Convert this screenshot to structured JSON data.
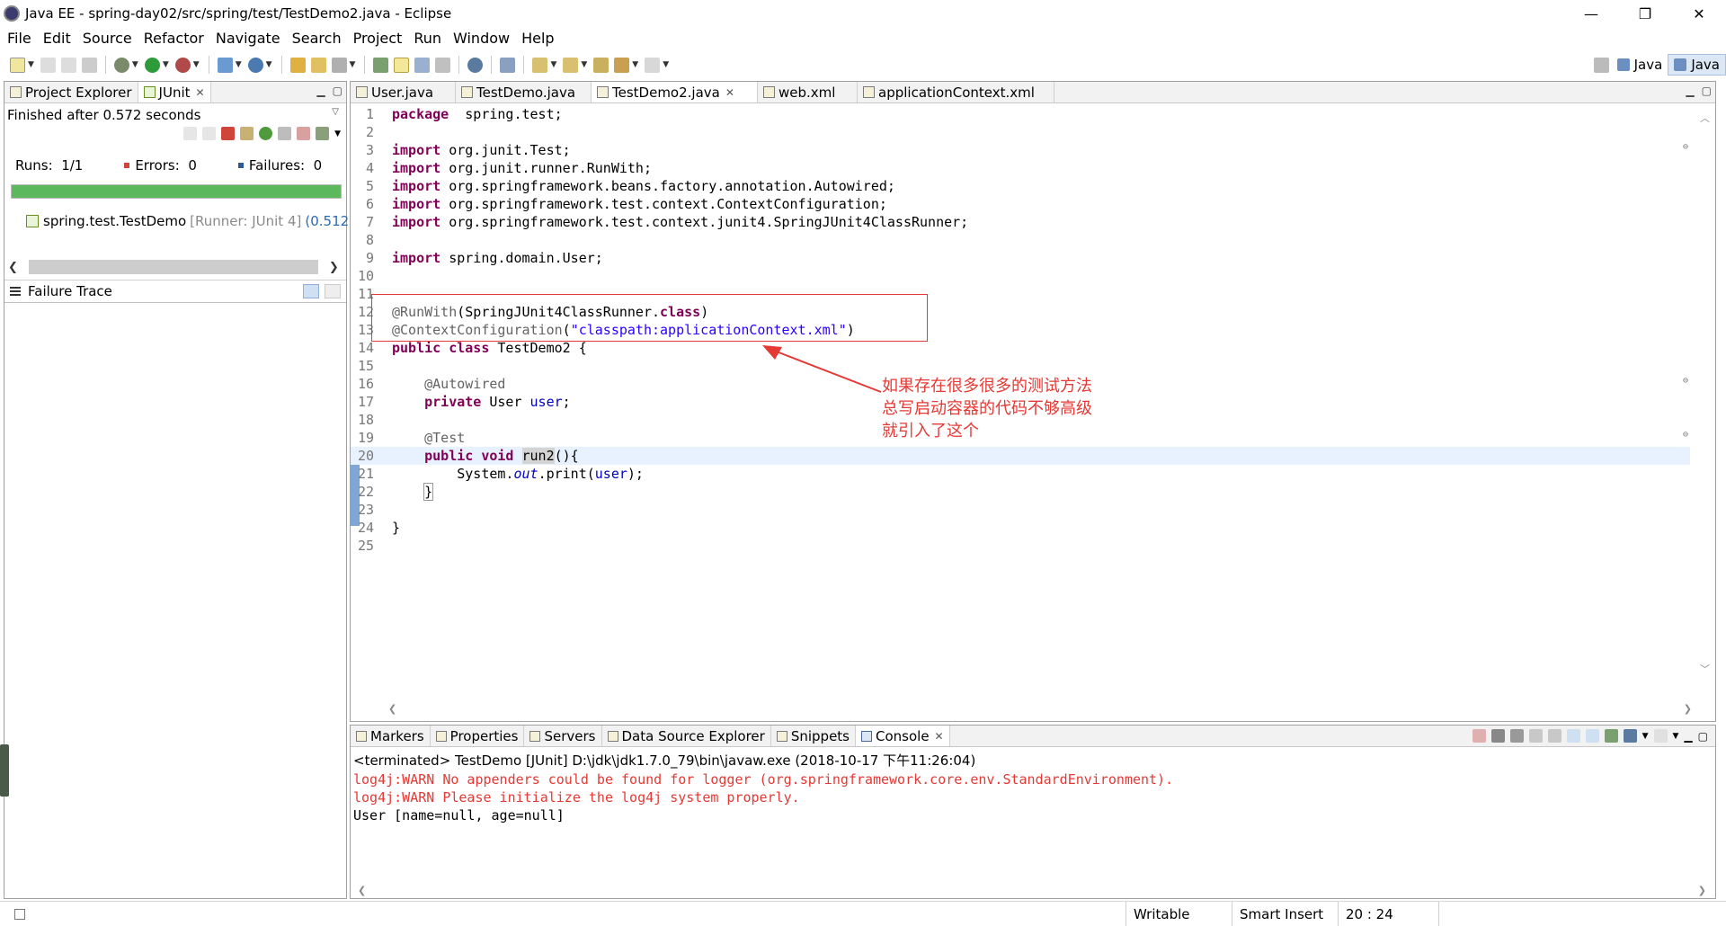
{
  "window": {
    "title": "Java EE - spring-day02/src/spring/test/TestDemo2.java - Eclipse",
    "controls": [
      "—",
      "❐",
      "✕"
    ]
  },
  "menu": [
    "File",
    "Edit",
    "Source",
    "Refactor",
    "Navigate",
    "Search",
    "Project",
    "Run",
    "Window",
    "Help"
  ],
  "perspectives": [
    "Java",
    "Java"
  ],
  "left_panel": {
    "tabs": [
      "Project Explorer",
      "JUnit"
    ],
    "status": "Finished after 0.572 seconds",
    "runs_label": "Runs:",
    "runs_value": "1/1",
    "errors_label": "Errors:",
    "errors_value": "0",
    "failures_label": "Failures:",
    "failures_value": "0",
    "progress": 1.0,
    "progress_color": "#5cb85c",
    "tree_item": "spring.test.TestDemo",
    "tree_runner": "[Runner: JUnit 4]",
    "tree_time": "(0.512",
    "failure_trace": "Failure Trace"
  },
  "editor": {
    "tabs": [
      "User.java",
      "TestDemo.java",
      "TestDemo2.java",
      "web.xml",
      "applicationContext.xml"
    ],
    "active_tab": "TestDemo2.java",
    "lines": [
      {
        "n": "1",
        "segs": [
          [
            "kw",
            "package"
          ],
          [
            "",
            "  spring.test;"
          ]
        ]
      },
      {
        "n": "2",
        "segs": []
      },
      {
        "n": "3",
        "fold": true,
        "segs": [
          [
            "kw",
            "import"
          ],
          [
            "",
            " org.junit.Test;"
          ]
        ]
      },
      {
        "n": "4",
        "segs": [
          [
            "kw",
            "import"
          ],
          [
            "",
            " org.junit.runner.RunWith;"
          ]
        ]
      },
      {
        "n": "5",
        "segs": [
          [
            "kw",
            "import"
          ],
          [
            "",
            " org.springframework.beans.factory.annotation.Autowired;"
          ]
        ]
      },
      {
        "n": "6",
        "segs": [
          [
            "kw",
            "import"
          ],
          [
            "",
            " org.springframework.test.context.ContextConfiguration;"
          ]
        ]
      },
      {
        "n": "7",
        "segs": [
          [
            "kw",
            "import"
          ],
          [
            "",
            " org.springframework.test.context.junit4.SpringJUnit4ClassRunner;"
          ]
        ]
      },
      {
        "n": "8",
        "segs": []
      },
      {
        "n": "9",
        "segs": [
          [
            "kw",
            "import"
          ],
          [
            "",
            " spring.domain.User;"
          ]
        ]
      },
      {
        "n": "10",
        "segs": []
      },
      {
        "n": "11",
        "segs": []
      },
      {
        "n": "12",
        "segs": [
          [
            "ann",
            "@RunWith"
          ],
          [
            "",
            "(SpringJUnit4ClassRunner."
          ],
          [
            "kw",
            "class"
          ],
          [
            "",
            ")"
          ]
        ]
      },
      {
        "n": "13",
        "segs": [
          [
            "ann",
            "@ContextConfiguration"
          ],
          [
            "",
            "("
          ],
          [
            "str",
            "\"classpath:applicationContext.xml\""
          ],
          [
            "",
            ")"
          ]
        ]
      },
      {
        "n": "14",
        "segs": [
          [
            "kw",
            "public"
          ],
          [
            "",
            " "
          ],
          [
            "kw",
            "class"
          ],
          [
            "",
            " TestDemo2 {"
          ]
        ]
      },
      {
        "n": "15",
        "segs": []
      },
      {
        "n": "16",
        "fold": true,
        "segs": [
          [
            "",
            "    "
          ],
          [
            "ann",
            "@Autowired"
          ]
        ]
      },
      {
        "n": "17",
        "segs": [
          [
            "",
            "    "
          ],
          [
            "kw",
            "private"
          ],
          [
            "",
            " User "
          ],
          [
            "fld",
            "user"
          ],
          [
            "",
            ";"
          ]
        ]
      },
      {
        "n": "18",
        "segs": []
      },
      {
        "n": "19",
        "fold": true,
        "segs": [
          [
            "",
            "    "
          ],
          [
            "ann",
            "@Test"
          ]
        ]
      },
      {
        "n": "20",
        "hl": true,
        "segs": [
          [
            "",
            "    "
          ],
          [
            "kw",
            "public"
          ],
          [
            "",
            " "
          ],
          [
            "kw",
            "void"
          ],
          [
            "",
            " "
          ],
          [
            "mark",
            "run2"
          ],
          [
            "",
            "(){"
          ]
        ]
      },
      {
        "n": "21",
        "segs": [
          [
            "",
            "        System."
          ],
          [
            "fldi",
            "out"
          ],
          [
            "",
            ".print("
          ],
          [
            "fld",
            "user"
          ],
          [
            "",
            ");"
          ]
        ]
      },
      {
        "n": "22",
        "segs": [
          [
            "",
            "    "
          ],
          [
            "box",
            "}"
          ]
        ]
      },
      {
        "n": "23",
        "segs": []
      },
      {
        "n": "24",
        "segs": [
          [
            "",
            "}"
          ]
        ]
      },
      {
        "n": "25",
        "segs": []
      }
    ],
    "annotation_note": [
      "如果存在很多很多的测试方法",
      "总写启动容器的代码不够高级",
      "就引入了这个"
    ]
  },
  "console": {
    "tabs": [
      "Markers",
      "Properties",
      "Servers",
      "Data Source Explorer",
      "Snippets",
      "Console"
    ],
    "active_tab": "Console",
    "terminated": "<terminated> TestDemo [JUnit] D:\\jdk\\jdk1.7.0_79\\bin\\javaw.exe (2018-10-17 下午11:26:04)",
    "output": [
      {
        "type": "err",
        "text": "log4j:WARN No appenders could be found for logger (org.springframework.core.env.StandardEnvironment)."
      },
      {
        "type": "err",
        "text": "log4j:WARN Please initialize the log4j system properly."
      },
      {
        "type": "out",
        "text": "User [name=null, age=null]"
      }
    ]
  },
  "statusbar": {
    "writable": "Writable",
    "insert_mode": "Smart Insert",
    "position": "20 : 24"
  }
}
